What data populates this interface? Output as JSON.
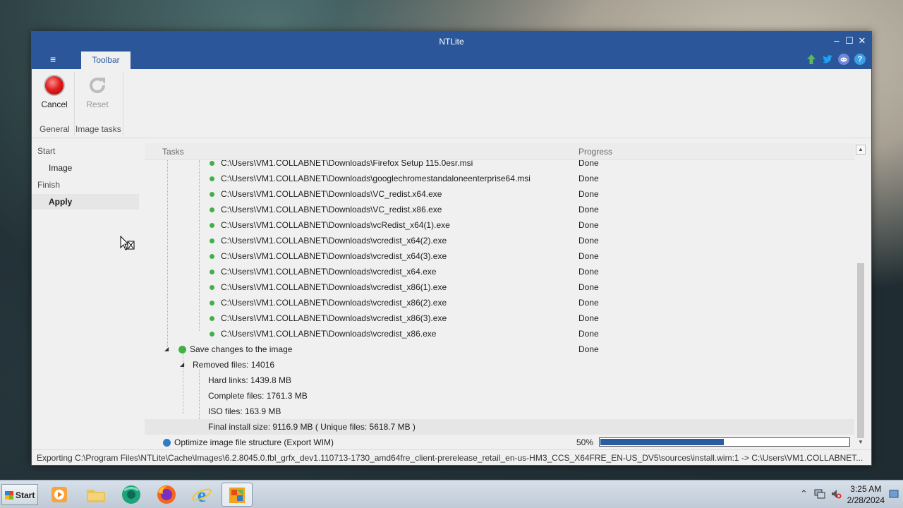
{
  "window": {
    "title": "NTLite",
    "minimize": "–",
    "maximize": "☐",
    "close": "✕"
  },
  "ribbon_tabs": {
    "menu_icon": "≡",
    "active_tab": "Toolbar",
    "icons": [
      "update-icon",
      "twitter-icon",
      "discord-icon",
      "help-icon"
    ]
  },
  "ribbon": {
    "cancel_label": "Cancel",
    "reset_label": "Reset",
    "group_general": "General",
    "group_image_tasks": "Image tasks"
  },
  "nav": {
    "start": "Start",
    "image": "Image",
    "finish": "Finish",
    "apply": "Apply"
  },
  "tasks": {
    "col_tasks": "Tasks",
    "col_progress": "Progress",
    "file_rows": [
      {
        "path": "C:\\Users\\VM1.COLLABNET\\Downloads\\Firefox Setup 115.0esr.msi",
        "status": "Done"
      },
      {
        "path": "C:\\Users\\VM1.COLLABNET\\Downloads\\googlechromestandaloneenterprise64.msi",
        "status": "Done"
      },
      {
        "path": "C:\\Users\\VM1.COLLABNET\\Downloads\\VC_redist.x64.exe",
        "status": "Done"
      },
      {
        "path": "C:\\Users\\VM1.COLLABNET\\Downloads\\VC_redist.x86.exe",
        "status": "Done"
      },
      {
        "path": "C:\\Users\\VM1.COLLABNET\\Downloads\\vcRedist_x64(1).exe",
        "status": "Done"
      },
      {
        "path": "C:\\Users\\VM1.COLLABNET\\Downloads\\vcredist_x64(2).exe",
        "status": "Done"
      },
      {
        "path": "C:\\Users\\VM1.COLLABNET\\Downloads\\vcredist_x64(3).exe",
        "status": "Done"
      },
      {
        "path": "C:\\Users\\VM1.COLLABNET\\Downloads\\vcredist_x64.exe",
        "status": "Done"
      },
      {
        "path": "C:\\Users\\VM1.COLLABNET\\Downloads\\vcredist_x86(1).exe",
        "status": "Done"
      },
      {
        "path": "C:\\Users\\VM1.COLLABNET\\Downloads\\vcredist_x86(2).exe",
        "status": "Done"
      },
      {
        "path": "C:\\Users\\VM1.COLLABNET\\Downloads\\vcredist_x86(3).exe",
        "status": "Done"
      },
      {
        "path": "C:\\Users\\VM1.COLLABNET\\Downloads\\vcredist_x86.exe",
        "status": "Done"
      }
    ],
    "save_changes": {
      "label": "Save changes to the image",
      "status": "Done"
    },
    "removed_files": "Removed files: 14016",
    "stats": [
      "Hard links: 1439.8 MB",
      "Complete files: 1761.3 MB",
      "ISO files: 163.9 MB",
      "Final install size: 9116.9 MB ( Unique files: 5618.7 MB )"
    ],
    "optimize": {
      "label": "Optimize image file structure (Export WIM)",
      "percent_text": "50%",
      "progress": 0.5
    }
  },
  "statusbar": {
    "text": "Exporting C:\\Program Files\\NTLite\\Cache\\Images\\6.2.8045.0.fbl_grfx_dev1.110713-1730_amd64fre_client-prerelease_retail_en-us-HM3_CCS_X64FRE_EN-US_DV5\\sources\\install.wim:1 -> C:\\Users\\VM1.COLLABNET..."
  },
  "taskbar": {
    "start_label": "Start",
    "apps": [
      "media-player-icon",
      "file-explorer-icon",
      "browser-icon",
      "firefox-icon",
      "internet-explorer-icon",
      "ntlite-icon"
    ],
    "time": "3:25 AM",
    "date": "2/28/2024"
  },
  "colors": {
    "accent": "#2b579a",
    "done_dot": "#43b047",
    "active_dot": "#2e7bc8",
    "progress_fill": "#2b5ba0"
  }
}
